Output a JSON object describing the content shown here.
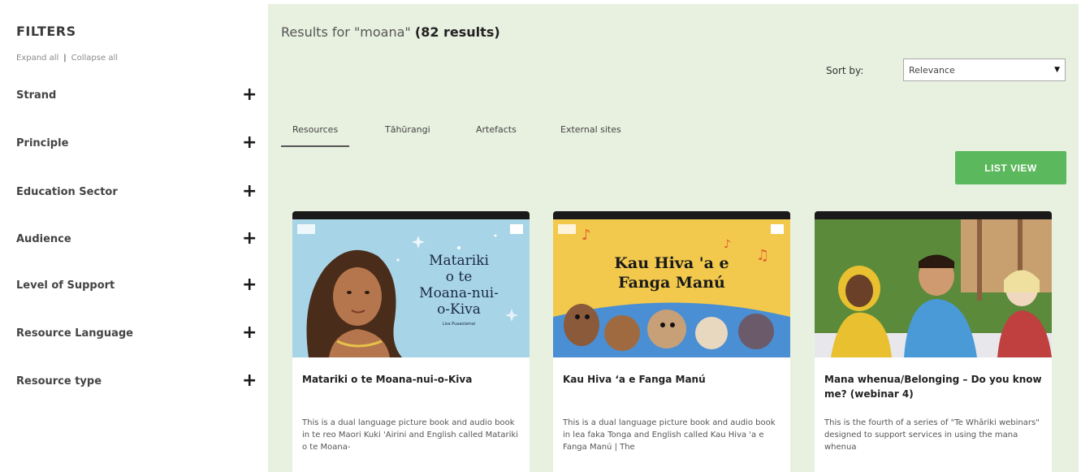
{
  "sidebar": {
    "title": "FILTERS",
    "expand_all": "Expand all",
    "separator": "|",
    "collapse_all": "Collapse all",
    "filters": [
      {
        "label": "Strand"
      },
      {
        "label": "Principle"
      },
      {
        "label": "Education Sector"
      },
      {
        "label": "Audience"
      },
      {
        "label": "Level of Support"
      },
      {
        "label": "Resource Language"
      },
      {
        "label": "Resource type"
      }
    ],
    "expand_symbol": "+"
  },
  "main": {
    "results_prefix": "Results for \"moana\" ",
    "results_count": "(82 results)",
    "sort_label": "Sort by:",
    "sort_value": "Relevance",
    "tabs": [
      {
        "label": "Resources",
        "active": true
      },
      {
        "label": "Tāhūrangi",
        "active": false
      },
      {
        "label": "Artefacts",
        "active": false
      },
      {
        "label": "External sites",
        "active": false
      }
    ],
    "list_view_label": "LIST VIEW",
    "cards": [
      {
        "title": "Matariki o te Moana-nui-o-Kiva",
        "description": "This is a dual language picture book and audio book in te reo Maori Kuki 'Airini and English called Matariki o te Moana-",
        "image_title_lines": [
          "Matariki",
          "o te",
          "Moana-nui-",
          "o-Kiva"
        ],
        "image_author": "Lisa Puaaoiamai"
      },
      {
        "title": "Kau Hiva ʻa e Fanga Manú",
        "description": "This is a dual language picture book and audio book in lea faka Tonga and English called Kau Hiva 'a e Fanga Manú | The",
        "image_title_lines": [
          "Kau Hiva 'a e",
          "Fanga Manú"
        ]
      },
      {
        "title": "Mana whenua/Belonging – Do you know me? (webinar 4)",
        "description": "This is the fourth of a series of \"Te Whāriki webinars\" designed to support services in using the mana whenua"
      }
    ]
  },
  "colors": {
    "main_bg": "#e8f0e0",
    "button_green": "#5cb85c"
  }
}
